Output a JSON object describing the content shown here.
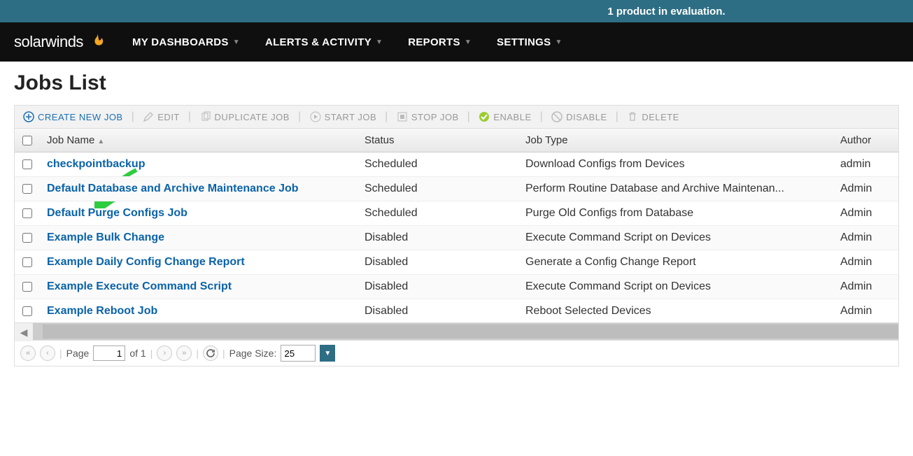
{
  "banner": {
    "text": "1 product in evaluation."
  },
  "brand": {
    "name": "solarwinds"
  },
  "nav": {
    "dashboards": "MY DASHBOARDS",
    "alerts": "ALERTS & ACTIVITY",
    "reports": "REPORTS",
    "settings": "SETTINGS"
  },
  "page": {
    "title": "Jobs List"
  },
  "toolbar": {
    "create": "CREATE NEW JOB",
    "edit": "EDIT",
    "duplicate": "DUPLICATE JOB",
    "start": "START JOB",
    "stop": "STOP JOB",
    "enable": "ENABLE",
    "disable": "DISABLE",
    "delete": "DELETE"
  },
  "columns": {
    "name": "Job Name",
    "status": "Status",
    "type": "Job Type",
    "author": "Author"
  },
  "rows": [
    {
      "name": "checkpointbackup",
      "status": "Scheduled",
      "type": "Download Configs from Devices",
      "author": "admin"
    },
    {
      "name": "Default Database and Archive Maintenance Job",
      "status": "Scheduled",
      "type": "Perform Routine Database and Archive Maintenan...",
      "author": "Admin"
    },
    {
      "name": "Default Purge Configs Job",
      "status": "Scheduled",
      "type": "Purge Old Configs from Database",
      "author": "Admin"
    },
    {
      "name": "Example Bulk Change",
      "status": "Disabled",
      "type": "Execute Command Script on Devices",
      "author": "Admin"
    },
    {
      "name": "Example Daily Config Change Report",
      "status": "Disabled",
      "type": "Generate a Config Change Report",
      "author": "Admin"
    },
    {
      "name": "Example Execute Command Script",
      "status": "Disabled",
      "type": "Execute Command Script on Devices",
      "author": "Admin"
    },
    {
      "name": "Example Reboot Job",
      "status": "Disabled",
      "type": "Reboot Selected Devices",
      "author": "Admin"
    }
  ],
  "pager": {
    "pageLabel": "Page",
    "page": "1",
    "ofTotal": "of 1",
    "sizeLabel": "Page Size:",
    "size": "25"
  }
}
